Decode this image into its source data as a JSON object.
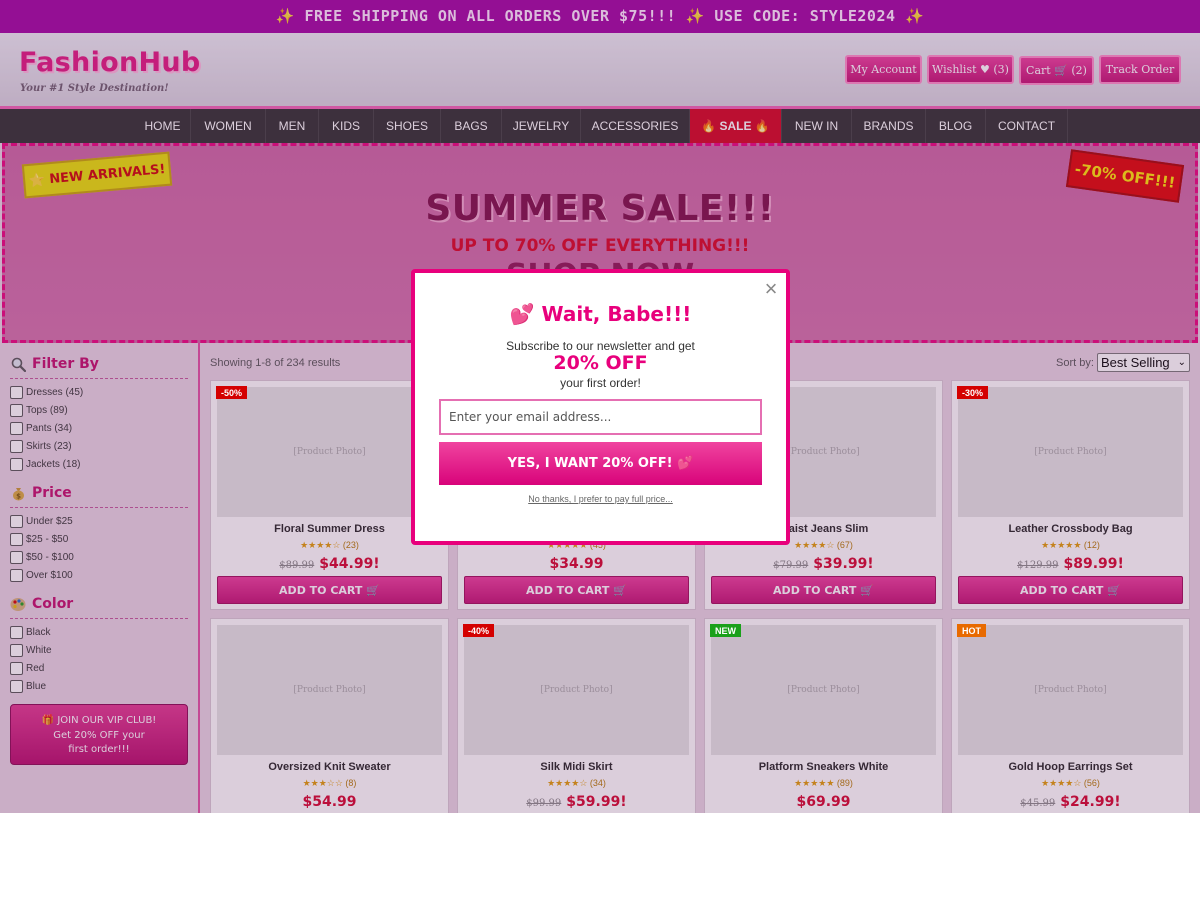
{
  "promo": {
    "text": "✨ FREE SHIPPING ON ALL ORDERS OVER $75!!! ✨ USE CODE: STYLE2024 ✨"
  },
  "header": {
    "logo": "FashionHub",
    "tagline": "Your #1 Style Destination!",
    "my_account": "My Account",
    "wishlist": "Wishlist ♥ (3)",
    "cart": "Cart 🛒 (2)",
    "track_order": "Track Order"
  },
  "nav": {
    "items": [
      "HOME",
      "WOMEN",
      "MEN",
      "KIDS",
      "SHOES",
      "BAGS",
      "JEWELRY",
      "ACCESSORIES",
      "🔥 SALE 🔥",
      "NEW IN",
      "BRANDS",
      "BLOG",
      "CONTACT"
    ]
  },
  "hero": {
    "sticker_new": "⭐ NEW ARRIVALS!",
    "sticker_off": "-70% OFF!!!",
    "title": "SUMMER SALE!!!",
    "subtitle": "UP TO 70% OFF EVERYTHING!!!",
    "cta": "SHOP NOW"
  },
  "sidebar": {
    "filter_title": "Filter By",
    "categories": [
      "Dresses (45)",
      "Tops (89)",
      "Pants (34)",
      "Skirts (23)",
      "Jackets (18)"
    ],
    "price_title": "Price",
    "prices": [
      "Under $25",
      "$25 - $50",
      "$50 - $100",
      "Over $100"
    ],
    "color_title": "Color",
    "colors": [
      "Black",
      "White",
      "Red",
      "Blue"
    ],
    "vip_line1": "🎁 JOIN OUR VIP CLUB!",
    "vip_line2": "Get 20% OFF your",
    "vip_line3": "first order!!!"
  },
  "listing": {
    "results": "Showing 1-8 of 234 results",
    "sort_label": "Sort by:",
    "sort_value": "Best Selling",
    "photo_placeholder": "[Product Photo]",
    "add_to_cart": "ADD TO CART 🛒"
  },
  "products": [
    {
      "name": "Floral Summer Dress",
      "stars": "★★★★☆",
      "count": "(23)",
      "old": "$89.99",
      "price": "$44.99!",
      "badge": "-50%",
      "badge_color": "#d40000"
    },
    {
      "name": "",
      "stars": "★★★★★",
      "count": "(45)",
      "old": "",
      "price": "$34.99",
      "badge": "",
      "badge_color": ""
    },
    {
      "name": "Waist Jeans Slim",
      "stars": "★★★★☆",
      "count": "(67)",
      "old": "$79.99",
      "price": "$39.99!",
      "badge": "",
      "badge_color": ""
    },
    {
      "name": "Leather Crossbody Bag",
      "stars": "★★★★★",
      "count": "(12)",
      "old": "$129.99",
      "price": "$89.99!",
      "badge": "-30%",
      "badge_color": "#d40000"
    },
    {
      "name": "Oversized Knit Sweater",
      "stars": "★★★☆☆",
      "count": "(8)",
      "old": "",
      "price": "$54.99",
      "badge": "",
      "badge_color": ""
    },
    {
      "name": "Silk Midi Skirt",
      "stars": "★★★★☆",
      "count": "(34)",
      "old": "$99.99",
      "price": "$59.99!",
      "badge": "-40%",
      "badge_color": "#d40000"
    },
    {
      "name": "Platform Sneakers White",
      "stars": "★★★★★",
      "count": "(89)",
      "old": "",
      "price": "$69.99",
      "badge": "NEW",
      "badge_color": "#1aa01a"
    },
    {
      "name": "Gold Hoop Earrings Set",
      "stars": "★★★★☆",
      "count": "(56)",
      "old": "$45.99",
      "price": "$24.99!",
      "badge": "HOT",
      "badge_color": "#e86a00"
    }
  ],
  "modal": {
    "title": "💕 Wait, Babe!!!",
    "line1": "Subscribe to our newsletter and get",
    "big": "20% OFF",
    "line2": "your first order!",
    "email_placeholder": "Enter your email address...",
    "cta": "YES, I WANT 20% OFF! 💕",
    "no_thanks": "No thanks, I prefer to pay full price...",
    "close": "×"
  },
  "colors": {
    "brand_pink": "#e8007c",
    "promo_purple": "#a100a0",
    "nav_dark": "#2c2c2c",
    "sale_red": "#d4001c"
  }
}
